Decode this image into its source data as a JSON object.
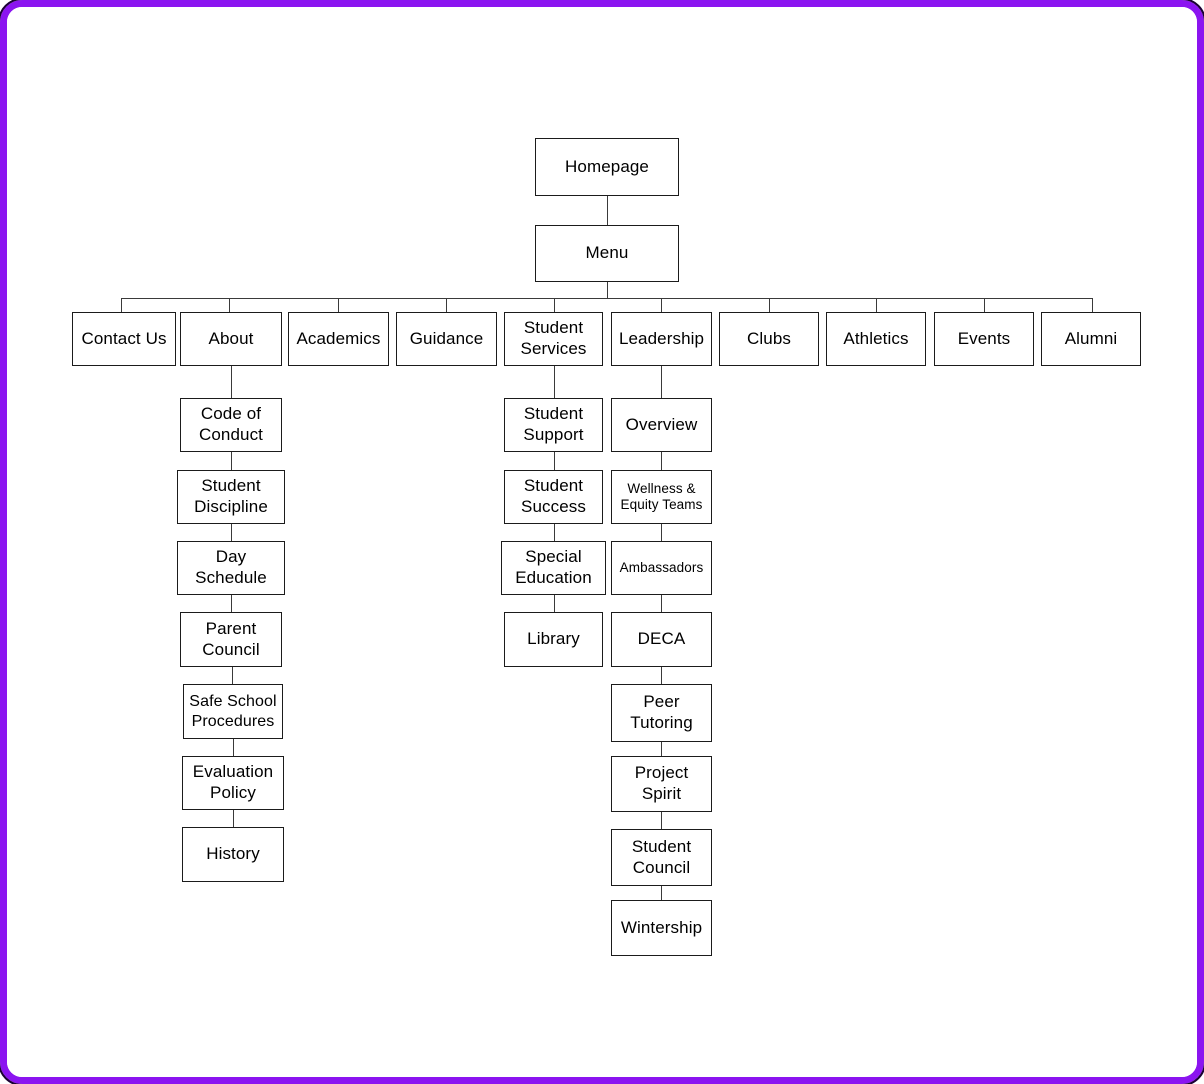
{
  "meta": {
    "title": "School Website Site Map",
    "frame_color": "#8b14f0",
    "node_border_color": "#1b1b1b",
    "connector_color": "#3a3a3a",
    "background": "#ffffff"
  },
  "chart_data": {
    "type": "diagram",
    "diagram_kind": "site-map-tree",
    "title": "School Website Site Map",
    "root": "Homepage",
    "levels": [
      {
        "level": 0,
        "nodes": [
          "Homepage"
        ]
      },
      {
        "level": 1,
        "nodes": [
          "Menu"
        ]
      },
      {
        "level": 2,
        "nodes": [
          "Contact Us",
          "About",
          "Academics",
          "Guidance",
          "Student Services",
          "Leadership",
          "Clubs",
          "Athletics",
          "Events",
          "Alumni"
        ]
      }
    ],
    "edges": [
      {
        "from": "Homepage",
        "to": "Menu"
      },
      {
        "from": "Menu",
        "to": "Contact Us"
      },
      {
        "from": "Menu",
        "to": "About"
      },
      {
        "from": "Menu",
        "to": "Academics"
      },
      {
        "from": "Menu",
        "to": "Guidance"
      },
      {
        "from": "Menu",
        "to": "Student Services"
      },
      {
        "from": "Menu",
        "to": "Leadership"
      },
      {
        "from": "Menu",
        "to": "Clubs"
      },
      {
        "from": "Menu",
        "to": "Athletics"
      },
      {
        "from": "Menu",
        "to": "Events"
      },
      {
        "from": "Menu",
        "to": "Alumni"
      },
      {
        "from": "About",
        "to": "Code of Conduct"
      },
      {
        "from": "Code of Conduct",
        "to": "Student Discipline"
      },
      {
        "from": "Student Discipline",
        "to": "Day Schedule"
      },
      {
        "from": "Day Schedule",
        "to": "Parent Council"
      },
      {
        "from": "Parent Council",
        "to": "Safe School Procedures"
      },
      {
        "from": "Safe School Procedures",
        "to": "Evaluation Policy"
      },
      {
        "from": "Evaluation Policy",
        "to": "History"
      },
      {
        "from": "Student Services",
        "to": "Student Support"
      },
      {
        "from": "Student Support",
        "to": "Student Success"
      },
      {
        "from": "Student Success",
        "to": "Special Education"
      },
      {
        "from": "Special Education",
        "to": "Library"
      },
      {
        "from": "Leadership",
        "to": "Overview"
      },
      {
        "from": "Overview",
        "to": "Wellness & Equity Teams"
      },
      {
        "from": "Wellness & Equity Teams",
        "to": "Ambassadors"
      },
      {
        "from": "Ambassadors",
        "to": "DECA"
      },
      {
        "from": "DECA",
        "to": "Peer Tutoring"
      },
      {
        "from": "Peer Tutoring",
        "to": "Project Spirit"
      },
      {
        "from": "Project Spirit",
        "to": "Student Council"
      },
      {
        "from": "Student Council",
        "to": "Wintership"
      }
    ]
  },
  "nodes": {
    "homepage": {
      "label": "Homepage"
    },
    "menu": {
      "label": "Menu"
    },
    "contact_us": {
      "label": "Contact Us"
    },
    "about": {
      "label": "About"
    },
    "academics": {
      "label": "Academics"
    },
    "guidance": {
      "label": "Guidance"
    },
    "student_services": {
      "label": "Student\nServices"
    },
    "leadership": {
      "label": "Leadership"
    },
    "clubs": {
      "label": "Clubs"
    },
    "athletics": {
      "label": "Athletics"
    },
    "events": {
      "label": "Events"
    },
    "alumni": {
      "label": "Alumni"
    },
    "code_of_conduct": {
      "label": "Code of\nConduct"
    },
    "student_discipline": {
      "label": "Student\nDiscipline"
    },
    "day_schedule": {
      "label": "Day\nSchedule"
    },
    "parent_council": {
      "label": "Parent\nCouncil"
    },
    "safe_school": {
      "label": "Safe School\nProcedures"
    },
    "evaluation_policy": {
      "label": "Evaluation\nPolicy"
    },
    "history": {
      "label": "History"
    },
    "student_support": {
      "label": "Student\nSupport"
    },
    "student_success": {
      "label": "Student\nSuccess"
    },
    "special_education": {
      "label": "Special\nEducation"
    },
    "library": {
      "label": "Library"
    },
    "overview": {
      "label": "Overview"
    },
    "wellness_equity": {
      "label": "Wellness &\nEquity Teams"
    },
    "ambassadors": {
      "label": "Ambassadors"
    },
    "deca": {
      "label": "DECA"
    },
    "peer_tutoring": {
      "label": "Peer\nTutoring"
    },
    "project_spirit": {
      "label": "Project\nSpirit"
    },
    "student_council": {
      "label": "Student\nCouncil"
    },
    "wintership": {
      "label": "Wintership"
    }
  }
}
